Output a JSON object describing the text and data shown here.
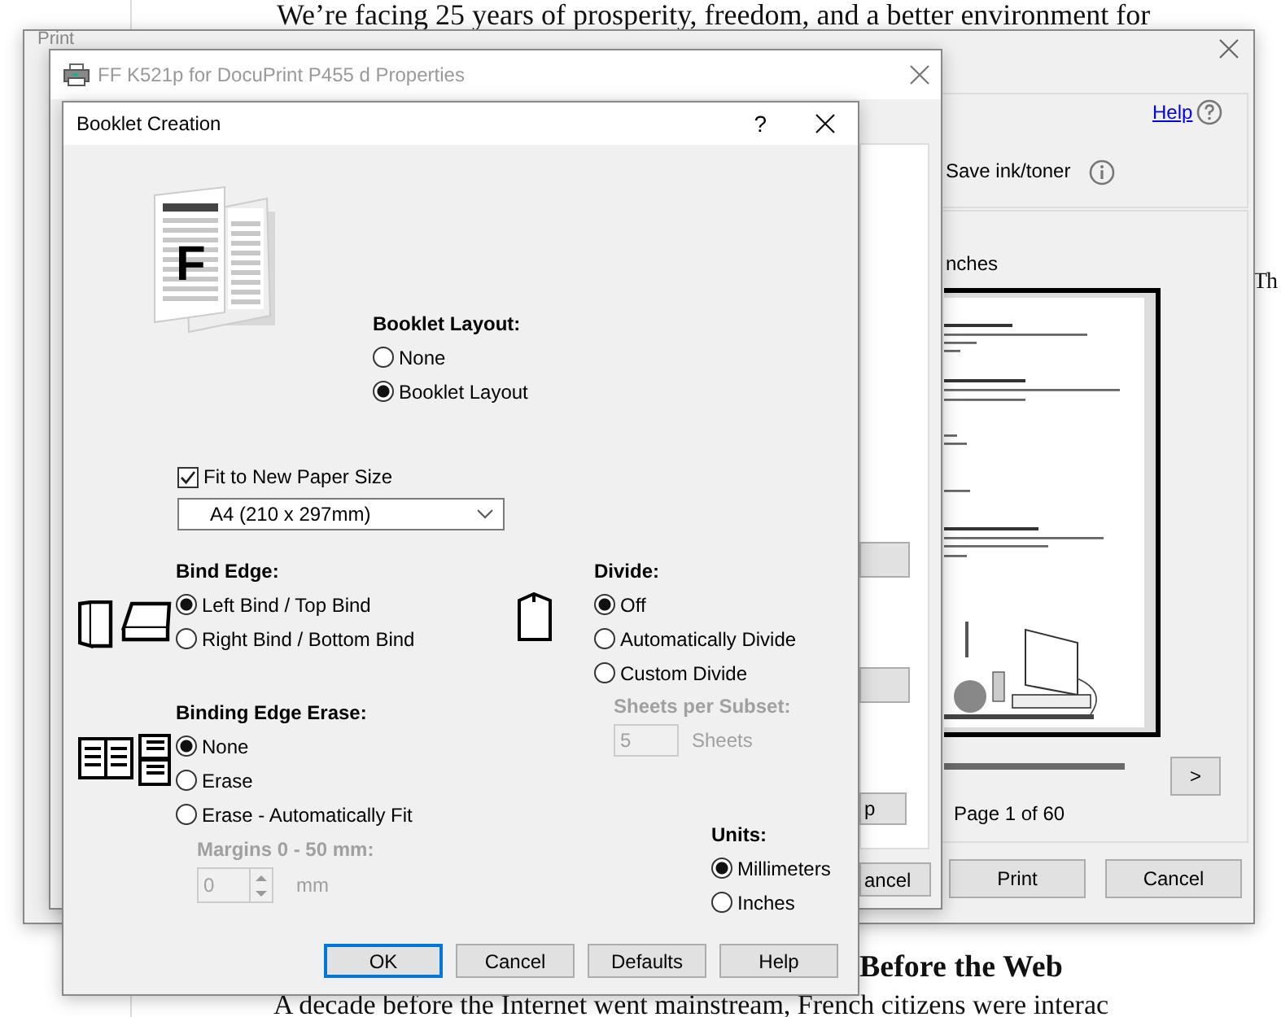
{
  "document": {
    "top_line": "We’re facing 25 years of prosperity, freedom, and a better environment for",
    "side_fragment": "Th",
    "heading": "Before the Web",
    "bottom_line": "A decade before the Internet went mainstream, French citizens were interac"
  },
  "print_dialog": {
    "title": "Print",
    "help_link": "Help",
    "save_ink_label": "Save ink/toner",
    "units_fragment": "nches",
    "page_status": "Page 1 of 60",
    "next_button": ">",
    "buttons": [
      "Print",
      "Cancel"
    ]
  },
  "properties_window": {
    "title": "FF K521p for DocuPrint P455 d Properties",
    "buttons": [
      "p",
      "ancel"
    ]
  },
  "booklet_dialog": {
    "title": "Booklet Creation",
    "help_glyph": "?",
    "preview_glyph": "F",
    "booklet_layout": {
      "heading": "Booklet Layout:",
      "options": [
        {
          "label": "None",
          "selected": false
        },
        {
          "label": "Booklet Layout",
          "selected": true
        }
      ]
    },
    "fit_to_paper": {
      "label": "Fit to New Paper Size",
      "checked": true
    },
    "paper_size": {
      "value": "A4 (210 x 297mm)"
    },
    "bind_edge": {
      "heading": "Bind Edge:",
      "options": [
        {
          "label": "Left Bind / Top Bind",
          "selected": true
        },
        {
          "label": "Right Bind / Bottom Bind",
          "selected": false
        }
      ]
    },
    "divide": {
      "heading": "Divide:",
      "options": [
        {
          "label": "Off",
          "selected": true
        },
        {
          "label": "Automatically Divide",
          "selected": false
        },
        {
          "label": "Custom Divide",
          "selected": false
        }
      ],
      "sheets_per_subset": {
        "label": "Sheets per Subset:",
        "value": "5",
        "unit": "Sheets",
        "disabled": true
      }
    },
    "binding_edge_erase": {
      "heading": "Binding Edge Erase:",
      "options": [
        {
          "label": "None",
          "selected": true
        },
        {
          "label": "Erase",
          "selected": false
        },
        {
          "label": "Erase - Automatically Fit",
          "selected": false
        }
      ],
      "margins": {
        "label": "Margins 0 - 50 mm:",
        "value": "0",
        "unit": "mm",
        "disabled": true
      }
    },
    "units": {
      "heading": "Units:",
      "options": [
        {
          "label": "Millimeters",
          "selected": true
        },
        {
          "label": "Inches",
          "selected": false
        }
      ]
    },
    "buttons": [
      {
        "label": "OK",
        "default": true
      },
      {
        "label": "Cancel",
        "default": false
      },
      {
        "label": "Defaults",
        "default": false
      },
      {
        "label": "Help",
        "default": false
      }
    ]
  }
}
